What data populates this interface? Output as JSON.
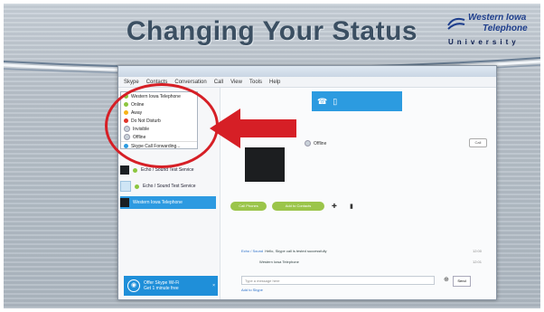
{
  "slide": {
    "title": "Changing Your Status",
    "logo": {
      "line1": "Western Iowa",
      "line2": "Telephone",
      "line3": "University"
    }
  },
  "skype": {
    "menu": [
      "Skype",
      "Contacts",
      "Conversation",
      "Call",
      "View",
      "Tools",
      "Help"
    ],
    "dropdown": {
      "header": "Western Iowa Telephone",
      "items": [
        {
          "label": "Online",
          "color": "#8cc63f"
        },
        {
          "label": "Away",
          "color": "#f6b318"
        },
        {
          "label": "Do Not Disturb",
          "color": "#e0342a"
        },
        {
          "label": "Invisible",
          "color": "#c9d1d9"
        },
        {
          "label": "Offline",
          "color": "#c9d1d9"
        }
      ],
      "footer": "Skype Call Forwarding..."
    },
    "contacts": [
      {
        "name": "Echo / Sound Test Service",
        "sub": ""
      },
      {
        "name": "Echo / Sound Test Service",
        "sub": ""
      },
      {
        "name": "Western Iowa Telephone",
        "sub": ""
      }
    ],
    "promo": {
      "title": "Offer Skype Wi-Fi",
      "sub": "Get 1 minute free",
      "close": "×"
    },
    "profile": {
      "status": "Offline",
      "chip": "Call"
    },
    "buttons": {
      "call": "Call Phones",
      "add": "Add to Contacts"
    },
    "chat": {
      "line1_name": "Echo / Sound",
      "line1_text": "Hello, Skype call is tested successfully",
      "line1_time": "12:00",
      "line2_text": "Western Iowa Telephone",
      "line2_time": "12:01",
      "input_placeholder": "Type a message here",
      "send": "Send",
      "sub_link": "Add to Skype"
    }
  },
  "colors": {
    "accent": "#2c9be0",
    "annotation": "#d61f26",
    "title": "#3b4f62"
  }
}
